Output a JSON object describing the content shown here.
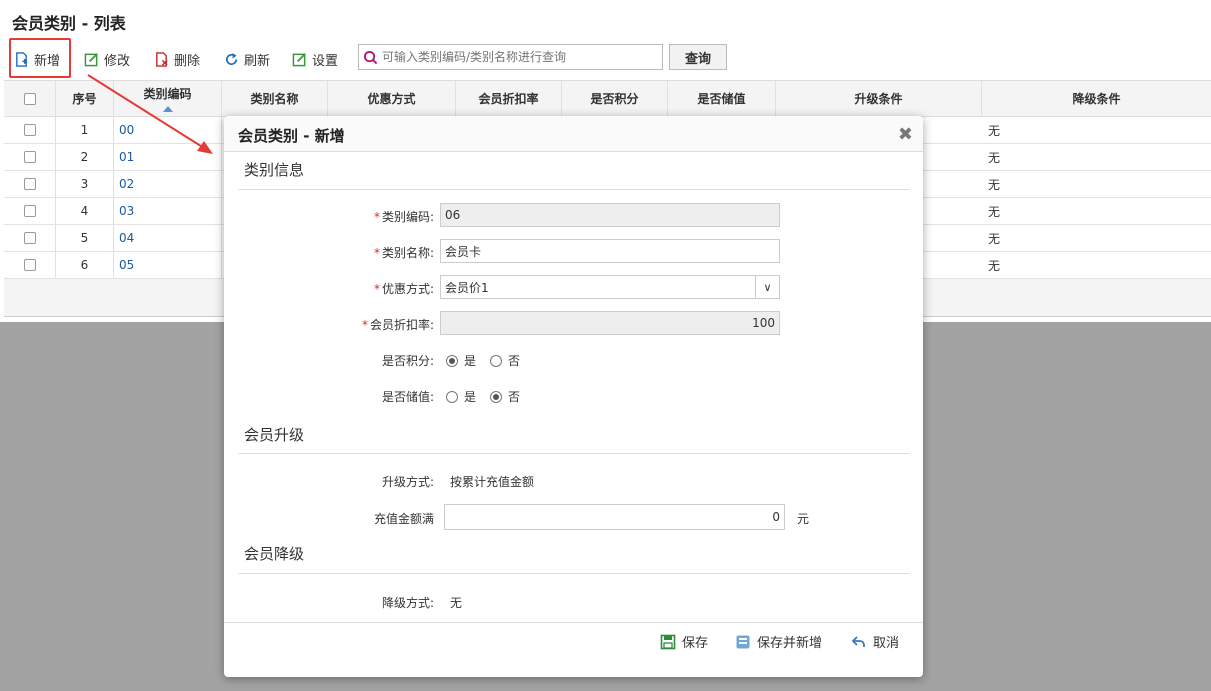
{
  "page": {
    "title": "会员类别 - 列表"
  },
  "toolbar": {
    "add_label": "新增",
    "edit_label": "修改",
    "delete_label": "删除",
    "refresh_label": "刷新",
    "settings_label": "设置",
    "search_placeholder": "可输入类别编码/类别名称进行查询",
    "query_label": "查询"
  },
  "grid": {
    "columns": [
      "序号",
      "类别编码",
      "类别名称",
      "优惠方式",
      "会员折扣率",
      "是否积分",
      "是否储值",
      "升级条件",
      "降级条件"
    ],
    "rows": [
      {
        "index": "1",
        "code": "00",
        "downgrade": "无"
      },
      {
        "index": "2",
        "code": "01",
        "downgrade": "无"
      },
      {
        "index": "3",
        "code": "02",
        "downgrade": "无"
      },
      {
        "index": "4",
        "code": "03",
        "downgrade": "无"
      },
      {
        "index": "5",
        "code": "04",
        "downgrade": "无"
      },
      {
        "index": "6",
        "code": "05",
        "downgrade": "无"
      }
    ]
  },
  "modal": {
    "title": "会员类别 - 新增",
    "section_info": "类别信息",
    "code_label": "类别编码:",
    "code_value": "06",
    "name_label": "类别名称:",
    "name_value": "会员卡",
    "discount_method_label": "优惠方式:",
    "discount_method_value": "会员价1",
    "discount_rate_label": "会员折扣率:",
    "discount_rate_value": "100",
    "points_label": "是否积分:",
    "points_yes": "是",
    "points_no": "否",
    "stored_value_label": "是否储值:",
    "stored_yes": "是",
    "stored_no": "否",
    "section_upgrade": "会员升级",
    "upgrade_method_label": "升级方式:",
    "upgrade_method_value": "按累计充值金额",
    "recharge_label": "充值金额满",
    "recharge_value": "0",
    "recharge_unit": "元",
    "section_downgrade": "会员降级",
    "downgrade_method_label": "降级方式:",
    "downgrade_method_value": "无",
    "save_label": "保存",
    "save_new_label": "保存并新增",
    "cancel_label": "取消"
  }
}
